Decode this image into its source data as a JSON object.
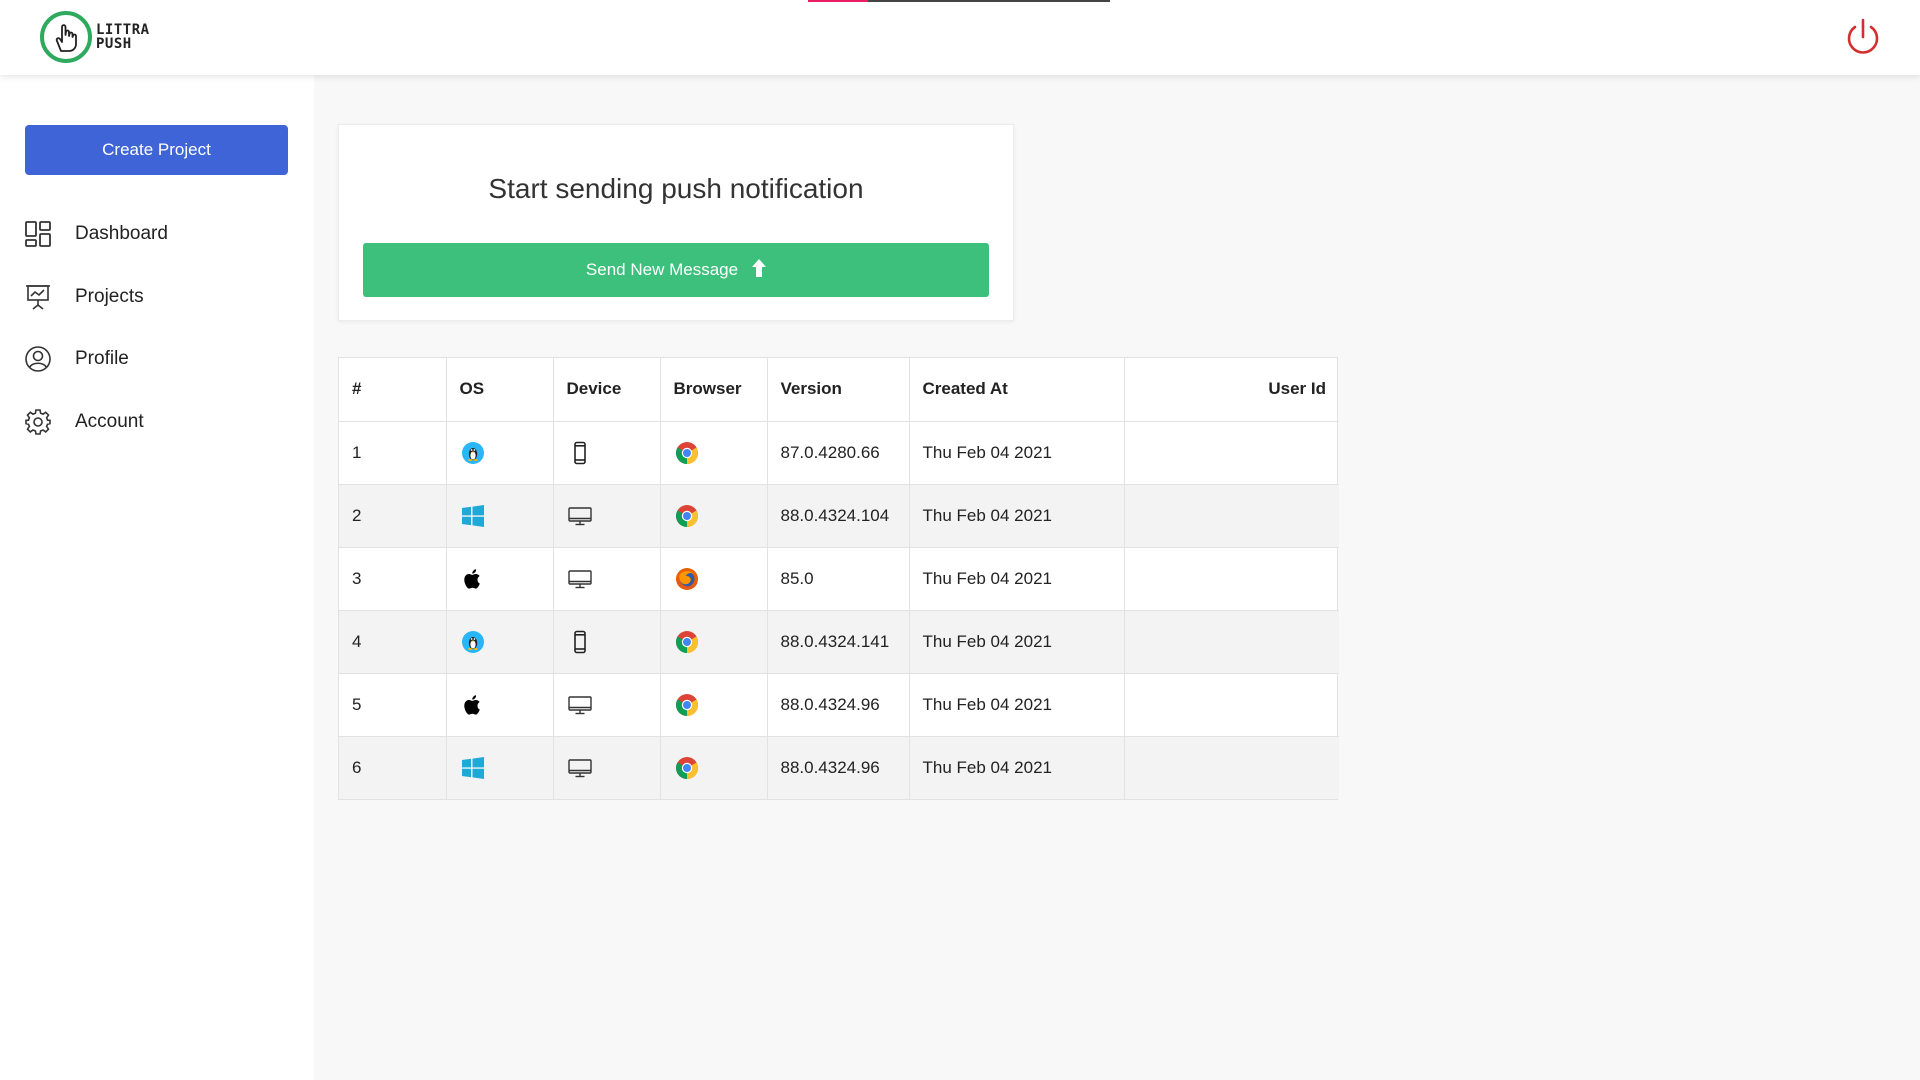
{
  "header": {
    "logo": {
      "text_line1": "LITTRA",
      "text_line2": "PUSH",
      "icon": "hand-pointer-icon"
    },
    "power_icon": "power-icon",
    "progress_fraction": 0.2
  },
  "sidebar": {
    "create_label": "Create Project",
    "items": [
      {
        "label": "Dashboard",
        "icon": "dashboard-icon"
      },
      {
        "label": "Projects",
        "icon": "presentation-icon"
      },
      {
        "label": "Profile",
        "icon": "user-circle-icon"
      },
      {
        "label": "Account",
        "icon": "gear-icon"
      }
    ]
  },
  "card": {
    "title": "Start sending push notification",
    "button_label": "Send New Message",
    "button_icon": "arrow-up-icon"
  },
  "table": {
    "headers": [
      "#",
      "OS",
      "Device",
      "Browser",
      "Version",
      "Created At",
      "User Id"
    ],
    "rows": [
      {
        "num": "1",
        "os": "linux",
        "device": "mobile",
        "browser": "chrome",
        "version": "87.0.4280.66",
        "created": "Thu Feb 04 2021",
        "user_id": ""
      },
      {
        "num": "2",
        "os": "windows",
        "device": "desktop",
        "browser": "chrome",
        "version": "88.0.4324.104",
        "created": "Thu Feb 04 2021",
        "user_id": ""
      },
      {
        "num": "3",
        "os": "apple",
        "device": "desktop",
        "browser": "firefox",
        "version": "85.0",
        "created": "Thu Feb 04 2021",
        "user_id": ""
      },
      {
        "num": "4",
        "os": "linux",
        "device": "mobile",
        "browser": "chrome",
        "version": "88.0.4324.141",
        "created": "Thu Feb 04 2021",
        "user_id": ""
      },
      {
        "num": "5",
        "os": "apple",
        "device": "desktop",
        "browser": "chrome",
        "version": "88.0.4324.96",
        "created": "Thu Feb 04 2021",
        "user_id": ""
      },
      {
        "num": "6",
        "os": "windows",
        "device": "desktop",
        "browser": "chrome",
        "version": "88.0.4324.96",
        "created": "Thu Feb 04 2021",
        "user_id": ""
      }
    ]
  },
  "colors": {
    "primary": "#3f64d8",
    "success": "#3cc07c",
    "brand_green": "#2eaa5f",
    "power_red": "#d32f2f",
    "progress": "#e91e63"
  }
}
